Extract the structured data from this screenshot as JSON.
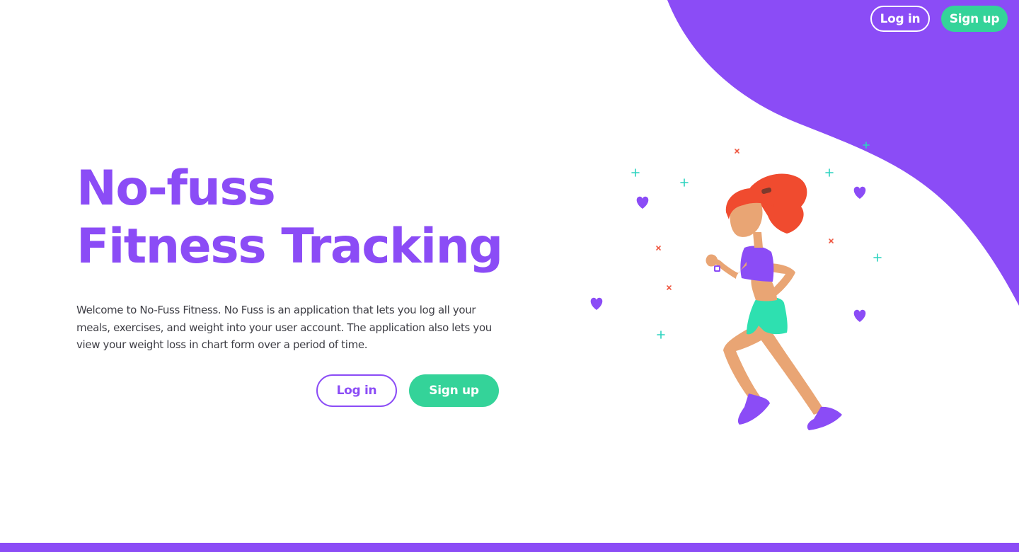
{
  "nav": {
    "login_label": "Log in",
    "signup_label": "Sign up"
  },
  "hero": {
    "title_line1": "No-fuss",
    "title_line2": "Fitness Tracking",
    "description": "Welcome to No-Fuss Fitness. No Fuss is an application that lets you log all your meals, exercises, and weight into your user account. The application also lets you view your weight loss in chart form over a period of time.",
    "login_label": "Log in",
    "signup_label": "Sign up"
  },
  "colors": {
    "brand_purple": "#8b4cf6",
    "accent_green": "#34d399",
    "text": "#3f3f46"
  },
  "illustration": {
    "icon": "running-woman-illustration"
  }
}
